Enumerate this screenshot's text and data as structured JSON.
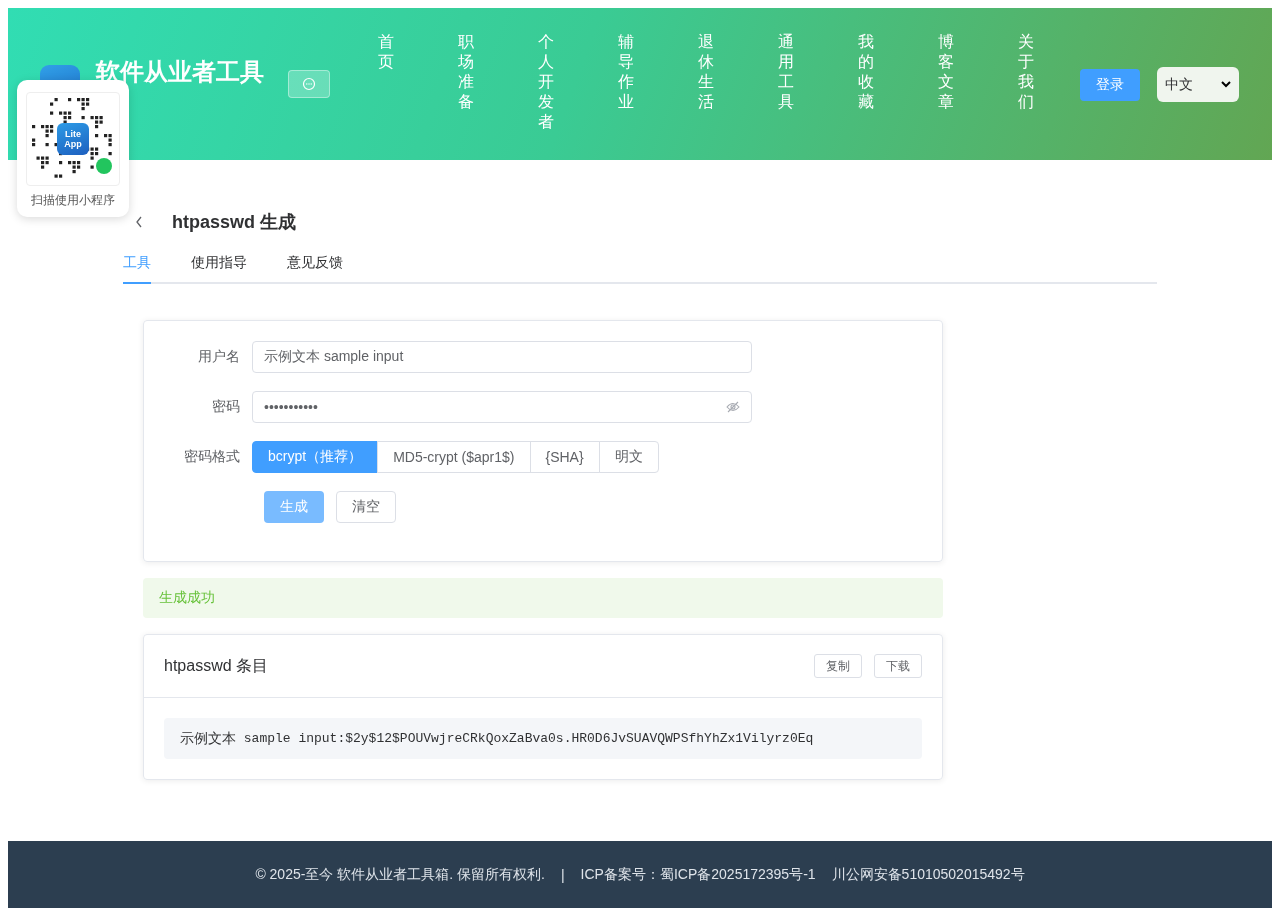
{
  "header": {
    "site_title": "软件从业者工具",
    "nav": [
      {
        "label": "首页"
      },
      {
        "label": "职场准备"
      },
      {
        "label": "个人开发者"
      },
      {
        "label": "辅导作业"
      },
      {
        "label": "退休生活"
      },
      {
        "label": "通用工具"
      },
      {
        "label": "我的收藏"
      },
      {
        "label": "博客文章"
      },
      {
        "label": "关于我们"
      }
    ],
    "login": "登录",
    "language": "中文"
  },
  "qr_popup": {
    "badge_line_1": "Lite",
    "badge_line_2": "App",
    "caption": "扫描使用小程序"
  },
  "page": {
    "title": "htpasswd 生成",
    "tabs": [
      {
        "label": "工具",
        "selected": true
      },
      {
        "label": "使用指导",
        "selected": false
      },
      {
        "label": "意见反馈",
        "selected": false
      }
    ]
  },
  "form": {
    "username_label": "用户名",
    "username_value": "示例文本 sample input",
    "password_label": "密码",
    "password_value": "•••••••••••",
    "format_label": "密码格式",
    "formats": [
      {
        "label": "bcrypt（推荐）",
        "selected": true
      },
      {
        "label": "MD5-crypt ($apr1$)",
        "selected": false
      },
      {
        "label": "{SHA}",
        "selected": false
      },
      {
        "label": "明文",
        "selected": false
      }
    ],
    "generate": "生成",
    "clear": "清空"
  },
  "alert": {
    "text": "生成成功"
  },
  "result": {
    "title": "htpasswd 条目",
    "copy": "复制",
    "download": "下载",
    "entry_prefix": "示例文本",
    "entry_rest": " sample input:$2y$12$POUVwjreCRkQoxZaBva0s.HR0D6JvSUAVQWPSfhYhZx1Vilyrz0Eq"
  },
  "footer": {
    "copyright": "© 2025-至今 软件从业者工具箱. 保留所有权利.",
    "separator": "|",
    "icp": "ICP备案号：蜀ICP备2025172395号-1",
    "police": "川公网安备51010502015492号"
  }
}
